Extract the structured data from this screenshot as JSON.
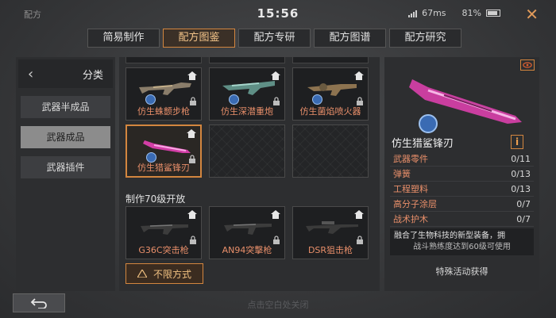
{
  "app": {
    "title": "配方",
    "time": "15:56",
    "network": "67ms",
    "battery": "81%"
  },
  "tabs": [
    {
      "label": "简易制作",
      "active": false
    },
    {
      "label": "配方图鉴",
      "active": true
    },
    {
      "label": "配方专研",
      "active": false
    },
    {
      "label": "配方图谱",
      "active": false
    },
    {
      "label": "配方研究",
      "active": false
    }
  ],
  "category": {
    "title": "分类",
    "items": [
      {
        "label": "武器半成品",
        "selected": false
      },
      {
        "label": "武器成品",
        "selected": true
      },
      {
        "label": "武器插件",
        "selected": false
      }
    ]
  },
  "grid": {
    "rows1": [
      {
        "label": "仿生蛛颤步枪",
        "locked": true
      },
      {
        "label": "仿生深潜重炮",
        "locked": true
      },
      {
        "label": "仿生菌焰喷火器",
        "locked": true
      }
    ],
    "selected_item": {
      "label": "仿生猎鲨锋刃",
      "locked": true
    },
    "section_title": "制作70级开放",
    "rows2": [
      {
        "label": "G36C突击枪",
        "locked": true
      },
      {
        "label": "AN94突擊枪",
        "locked": true
      },
      {
        "label": "DSR狙击枪",
        "locked": true
      }
    ],
    "mode_button": "不限方式"
  },
  "detail": {
    "name": "仿生猎鲨锋刃",
    "info_icon": "i",
    "materials": [
      {
        "name": "武器零件",
        "count": "0/11"
      },
      {
        "name": "弹簧",
        "count": "0/13"
      },
      {
        "name": "工程塑料",
        "count": "0/13"
      },
      {
        "name": "高分子涂层",
        "count": "0/7"
      },
      {
        "name": "战术护木",
        "count": "0/7"
      }
    ],
    "description": "融合了生物科技的新型装备，拥",
    "requirement": "战斗熟练度达到60级可使用",
    "obtain": "特殊活动获得"
  },
  "footer": {
    "hint": "点击空白处关闭"
  },
  "colors": {
    "accent": "#d3863f",
    "item_name": "#e98f6a",
    "selected_cat": "#8c8c8c"
  }
}
